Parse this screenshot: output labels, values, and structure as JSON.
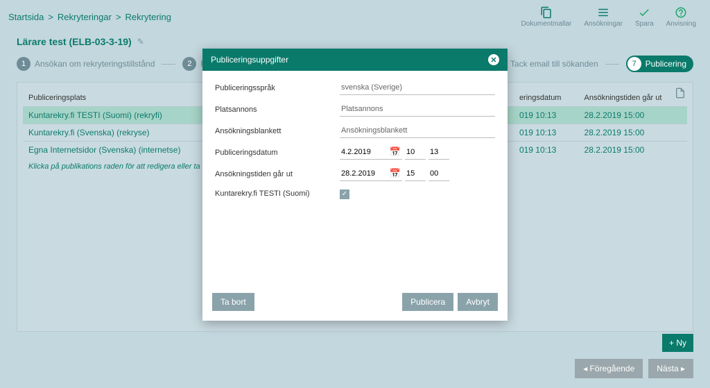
{
  "breadcrumb": {
    "home": "Startsida",
    "mid": "Rekryteringar",
    "last": "Rekrytering"
  },
  "top_actions": {
    "docs": "Dokumentmallar",
    "apps": "Ansökningar",
    "save": "Spara",
    "help": "Anvisning"
  },
  "page_title": "Lärare test (ELB-03-3-19)",
  "wizard": {
    "s1": "Ansökan om rekryteringstillstånd",
    "s2": "Rekryter",
    "s6": "Tack email till sökanden",
    "s7": "Publicering"
  },
  "table": {
    "headers": {
      "plats": "Publiceringsplats",
      "datum": "eringsdatum",
      "tid": "Ansökningstiden går ut"
    },
    "rows": [
      {
        "plats": "Kuntarekry.fi TESTI (Suomi) (rekryfi)",
        "datum": "019 10:13",
        "tid": "28.2.2019 15:00"
      },
      {
        "plats": "Kuntarekry.fi (Svenska) (rekryse)",
        "datum": "019 10:13",
        "tid": "28.2.2019 15:00"
      },
      {
        "plats": "Egna Internetsidor (Svenska) (internetse)",
        "datum": "019 10:13",
        "tid": "28.2.2019 15:00"
      }
    ],
    "hint": "Klicka på publikations raden för att redigera eller ta bort pub"
  },
  "buttons": {
    "ny": "+ Ny",
    "prev": "◂ Föregående",
    "next": "Nästa ▸"
  },
  "modal": {
    "title": "Publiceringsuppgifter",
    "labels": {
      "lang": "Publiceringsspråk",
      "annons": "Platsannons",
      "blank": "Ansökningsblankett",
      "pubdate": "Publiceringsdatum",
      "deadline": "Ansökningstiden går ut",
      "channel": "Kuntarekry.fi TESTI (Suomi)"
    },
    "values": {
      "lang": "svenska (Sverige)",
      "annons": "Platsannons",
      "blank": "Ansökningsblankett",
      "pubdate_d": "4.2.2019",
      "pubdate_h": "10",
      "pubdate_m": "13",
      "deadline_d": "28.2.2019",
      "deadline_h": "15",
      "deadline_m": "00"
    },
    "buttons": {
      "delete": "Ta bort",
      "publish": "Publicera",
      "cancel": "Avbryt"
    }
  }
}
